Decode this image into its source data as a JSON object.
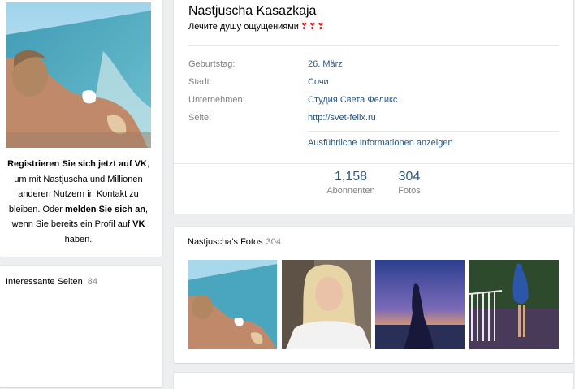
{
  "register": {
    "part1": "Registrieren Sie sich jetzt auf VK",
    "part2": ", um mit Nastjuscha und Millionen anderen Nutzern in Kontakt zu bleiben. Oder ",
    "part3": "melden Sie sich an",
    "part4": ", wenn Sie bereits ein Profil auf ",
    "part5": "VK",
    "part6": " haben."
  },
  "interesting_pages": {
    "label": "Interessante Seiten",
    "count": "84"
  },
  "profile": {
    "name": "Nastjuscha Kasazkaja",
    "status": "Лечите душу ощущениями",
    "status_hearts": "❣❣❣",
    "info": [
      {
        "label": "Geburtstag:",
        "value": "26. März"
      },
      {
        "label": "Stadt:",
        "value": "Сочи"
      },
      {
        "label": "Unternehmen:",
        "value": "Студия Света Феликс"
      },
      {
        "label": "Seite:",
        "value": "http://svet-felix.ru"
      }
    ],
    "more_link": "Ausführliche Informationen anzeigen",
    "counters": [
      {
        "number": "1,158",
        "label": "Abonnenten"
      },
      {
        "number": "304",
        "label": "Fotos"
      }
    ]
  },
  "photos": {
    "title": "Nastjuscha's Fotos",
    "count": "304"
  }
}
